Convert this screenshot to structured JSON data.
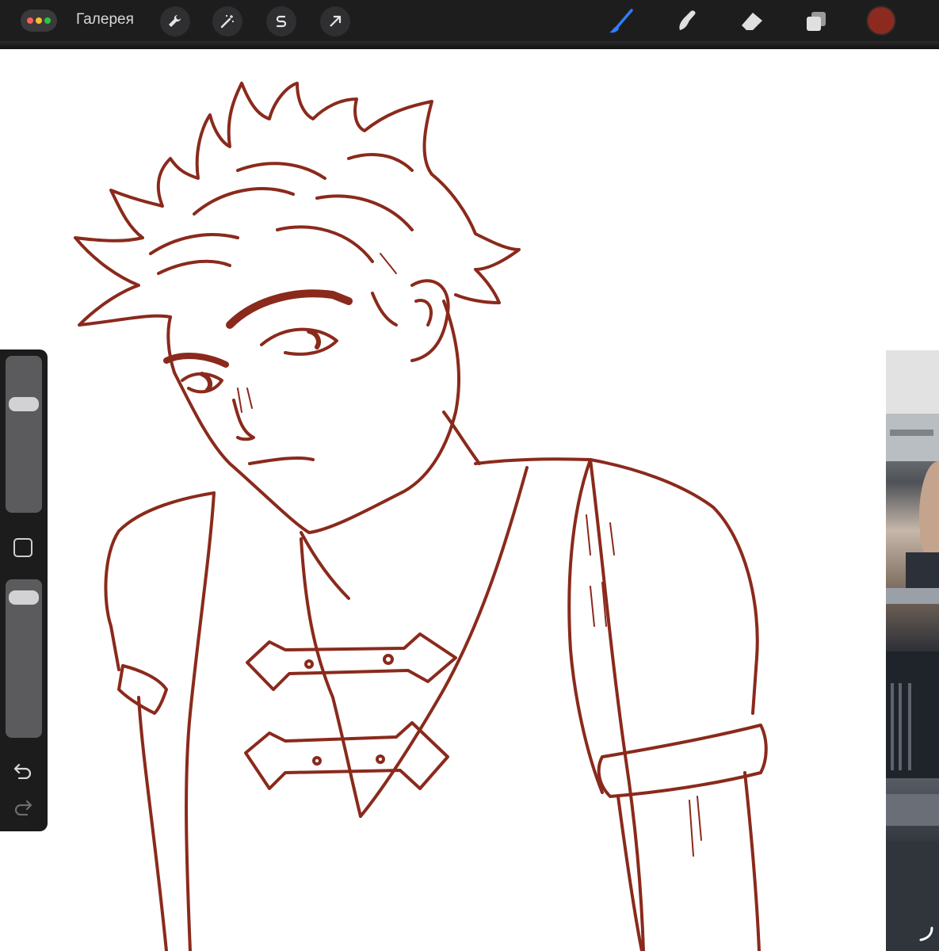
{
  "toolbar": {
    "gallery_label": "Галерея",
    "left_tools": [
      "wrench-icon",
      "magic-wand-icon",
      "selection-s-icon",
      "arrow-transform-icon"
    ],
    "right_tools": [
      "brush-icon",
      "smudge-icon",
      "eraser-icon",
      "layers-icon"
    ],
    "active_tool": "brush-icon",
    "current_color": "#8c2a1f",
    "accent_color": "#2d7ff9"
  },
  "sidebar": {
    "brush_size_level": 0.72,
    "opacity_level": 0.94,
    "buttons": [
      "modify-square-button",
      "undo-icon",
      "redo-icon"
    ]
  },
  "canvas": {
    "ink_color": "#8a2a1c",
    "background": "#ffffff"
  },
  "reference": {
    "content": "reference-photo"
  }
}
